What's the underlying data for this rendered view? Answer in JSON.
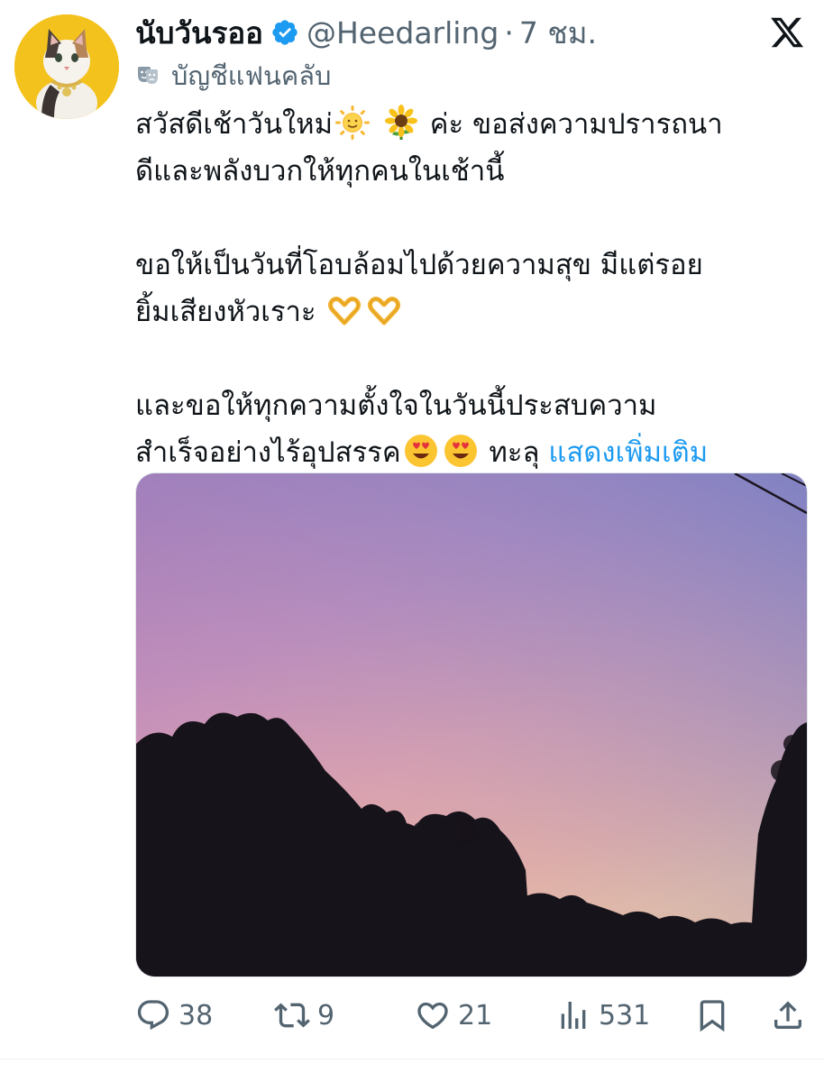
{
  "tweet": {
    "display_name": "นับวันรออ",
    "handle": "@Heedarling",
    "separator": "·",
    "time": "7 ชม.",
    "label": "บัญชีแฟนคลับ",
    "lines": {
      "l1a": "สวัสดีเช้าวันใหม่",
      "l1b": "ค่ะ ขอส่งความปรารถนา",
      "l2": "ดีและพลังบวกให้ทุกคนในเช้านี้",
      "l3": "ขอให้เป็นวันที่โอบล้อมไปด้วยความสุข มีแต่รอย",
      "l4": "ยิ้มเสียงหัวเราะ",
      "l5": "และขอให้ทุกความตั้งใจในวันนี้ประสบความ",
      "l6a": "สำเร็จอย่างไร้อุปสรรค",
      "l6b": "ทะลุ",
      "show_more": "แสดงเพิ่มเติม"
    },
    "emojis": [
      "sun-with-face",
      "sunflower",
      "heart-hands",
      "heart-hands",
      "heart-eyes",
      "heart-eyes"
    ]
  },
  "actions": {
    "replies": "38",
    "reposts": "9",
    "likes": "21",
    "views": "531"
  },
  "colors": {
    "link": "#1d9bf0",
    "muted": "#536471",
    "verified": "#1d9bf0",
    "avatar_bg": "#f4c21d"
  }
}
